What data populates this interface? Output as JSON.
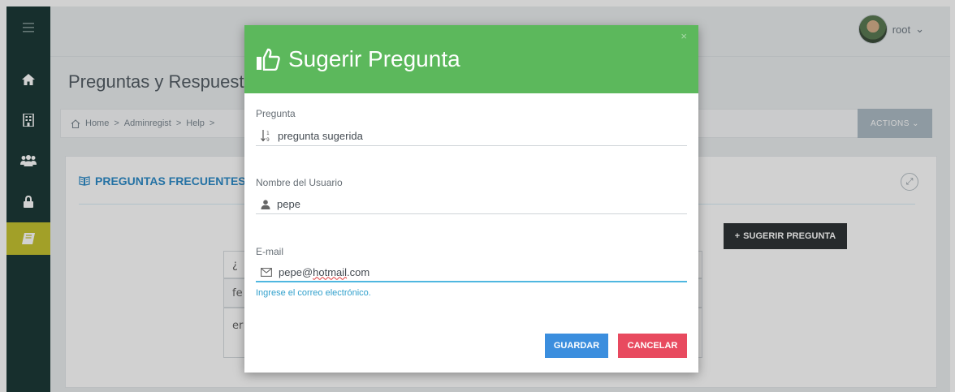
{
  "user": {
    "name": "root",
    "chevron": "⌄"
  },
  "sidebar": {
    "items": [
      {
        "icon": "menu-icon"
      },
      {
        "icon": "home-icon"
      },
      {
        "icon": "building-icon"
      },
      {
        "icon": "users-icon"
      },
      {
        "icon": "lock-icon"
      },
      {
        "icon": "book-icon",
        "active": true
      }
    ]
  },
  "page": {
    "title": "Preguntas y Respuestas"
  },
  "breadcrumb": {
    "items": [
      "Home",
      "Adminregist",
      "Help"
    ],
    "separator": ">"
  },
  "actions": {
    "label": "ACTIONS ⌄"
  },
  "panel": {
    "title": "PREGUNTAS FRECUENTES",
    "suggest_label": "SUGERIR PREGUNTA",
    "rows": [
      "¿",
      "fe",
      "er"
    ]
  },
  "modal": {
    "title": "Sugerir Pregunta",
    "close": "×",
    "fields": {
      "question": {
        "label": "Pregunta",
        "value": "pregunta sugerida"
      },
      "username": {
        "label": "Nombre del Usuario",
        "value": "pepe"
      },
      "email": {
        "label": "E-mail",
        "value_before": "pepe@",
        "value_misspelled": "hotmail",
        "value_after": ".com",
        "hint": "Ingrese el correo electrónico."
      }
    },
    "save_label": "GUARDAR",
    "cancel_label": "CANCELAR"
  },
  "colors": {
    "header_green": "#5cb85c",
    "sidebar_bg": "#1d3a38",
    "sidebar_active": "#c6c431",
    "save_blue": "#3b8ede",
    "cancel_red": "#e84a5f",
    "focus_blue": "#4fb7e0"
  }
}
